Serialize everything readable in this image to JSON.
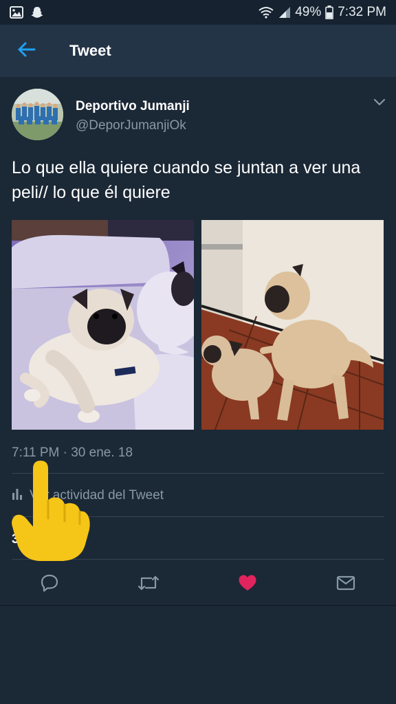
{
  "status_bar": {
    "battery": "49%",
    "time": "7:32 PM",
    "icons": [
      "image-icon",
      "snapchat-icon",
      "wifi-icon",
      "signal-icon",
      "battery-icon"
    ]
  },
  "app_bar": {
    "title": "Tweet",
    "back_icon": "arrow-left-icon"
  },
  "tweet": {
    "display_name": "Deportivo Jumanji",
    "handle": "@DeporJumanjiOk",
    "text": "Lo que ella quiere cuando se juntan a ver una peli// lo que él quiere",
    "timestamp": "7:11 PM · 30 ene. 18",
    "activity_label": "Ver actividad del Tweet",
    "likes_count": "3"
  },
  "actions": [
    "reply-icon",
    "retweet-icon",
    "like-icon",
    "share-icon"
  ],
  "colors": {
    "background": "#1b2836",
    "app_bar": "#243447",
    "accent": "#1da1f2",
    "like": "#e0245e",
    "secondary_text": "#8899a6",
    "overlay_hand": "#f5c518"
  }
}
